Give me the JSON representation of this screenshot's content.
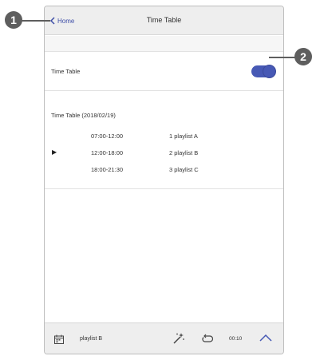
{
  "header": {
    "back_label": "Home",
    "title": "Time Table"
  },
  "timetable_row": {
    "label": "Time Table",
    "toggle_on": true
  },
  "schedule": {
    "title": "Time Table (2018/02/19)",
    "current_marker": "▶",
    "rows": [
      {
        "time": "07:00-12:00",
        "playlist": "1 playlist A",
        "current": false
      },
      {
        "time": "12:00-18:00",
        "playlist": "2 playlist B",
        "current": true
      },
      {
        "time": "18:00-21:30",
        "playlist": "3 playlist C",
        "current": false
      }
    ]
  },
  "footer": {
    "playlist_name": "playlist B",
    "time": "00:10"
  },
  "callouts": {
    "one": "1",
    "two": "2"
  },
  "colors": {
    "accent": "#4759b5",
    "callout": "#5e5e5e",
    "header_bg": "#eeeeee"
  }
}
